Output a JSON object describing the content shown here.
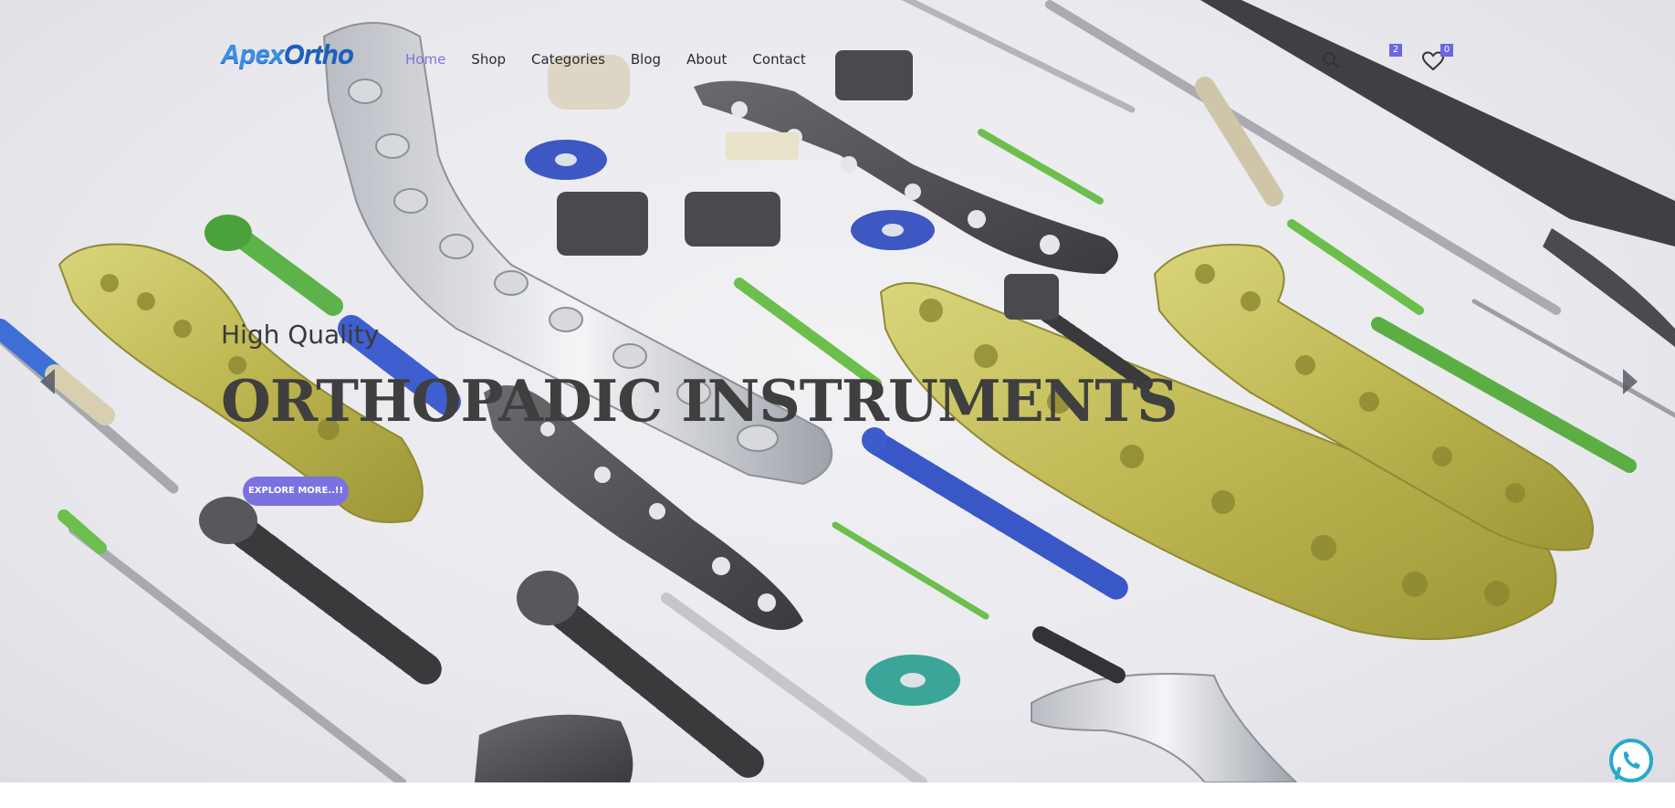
{
  "brand": {
    "logo_part1": "Apex",
    "logo_part2": "Ortho",
    "color": "#3b8ee6"
  },
  "nav": {
    "items": [
      {
        "label": "Home",
        "active": true
      },
      {
        "label": "Shop",
        "active": false
      },
      {
        "label": "Categories",
        "active": false
      },
      {
        "label": "Blog",
        "active": false
      },
      {
        "label": "About",
        "active": false
      },
      {
        "label": "Contact",
        "active": false
      }
    ],
    "accent_color": "#7b73e0"
  },
  "header_icons": {
    "search_icon": "search-icon",
    "cart_icon": "cart-icon",
    "cart_count": "2",
    "wishlist_icon": "heart-icon",
    "wishlist_count": "0"
  },
  "hero": {
    "subtitle": "High Quality",
    "title": "ORTHOPADIC INSTRUMENTS",
    "cta_label": "EXPLORE MORE..!!",
    "cta_color": "#7a72e0",
    "background": "orthopedic implants and instruments photo"
  },
  "slider": {
    "prev_icon": "chevron-left-icon",
    "next_icon": "chevron-right-icon"
  },
  "chat_widget": {
    "icon": "whatsapp-icon",
    "color": "#2aa9c8"
  }
}
